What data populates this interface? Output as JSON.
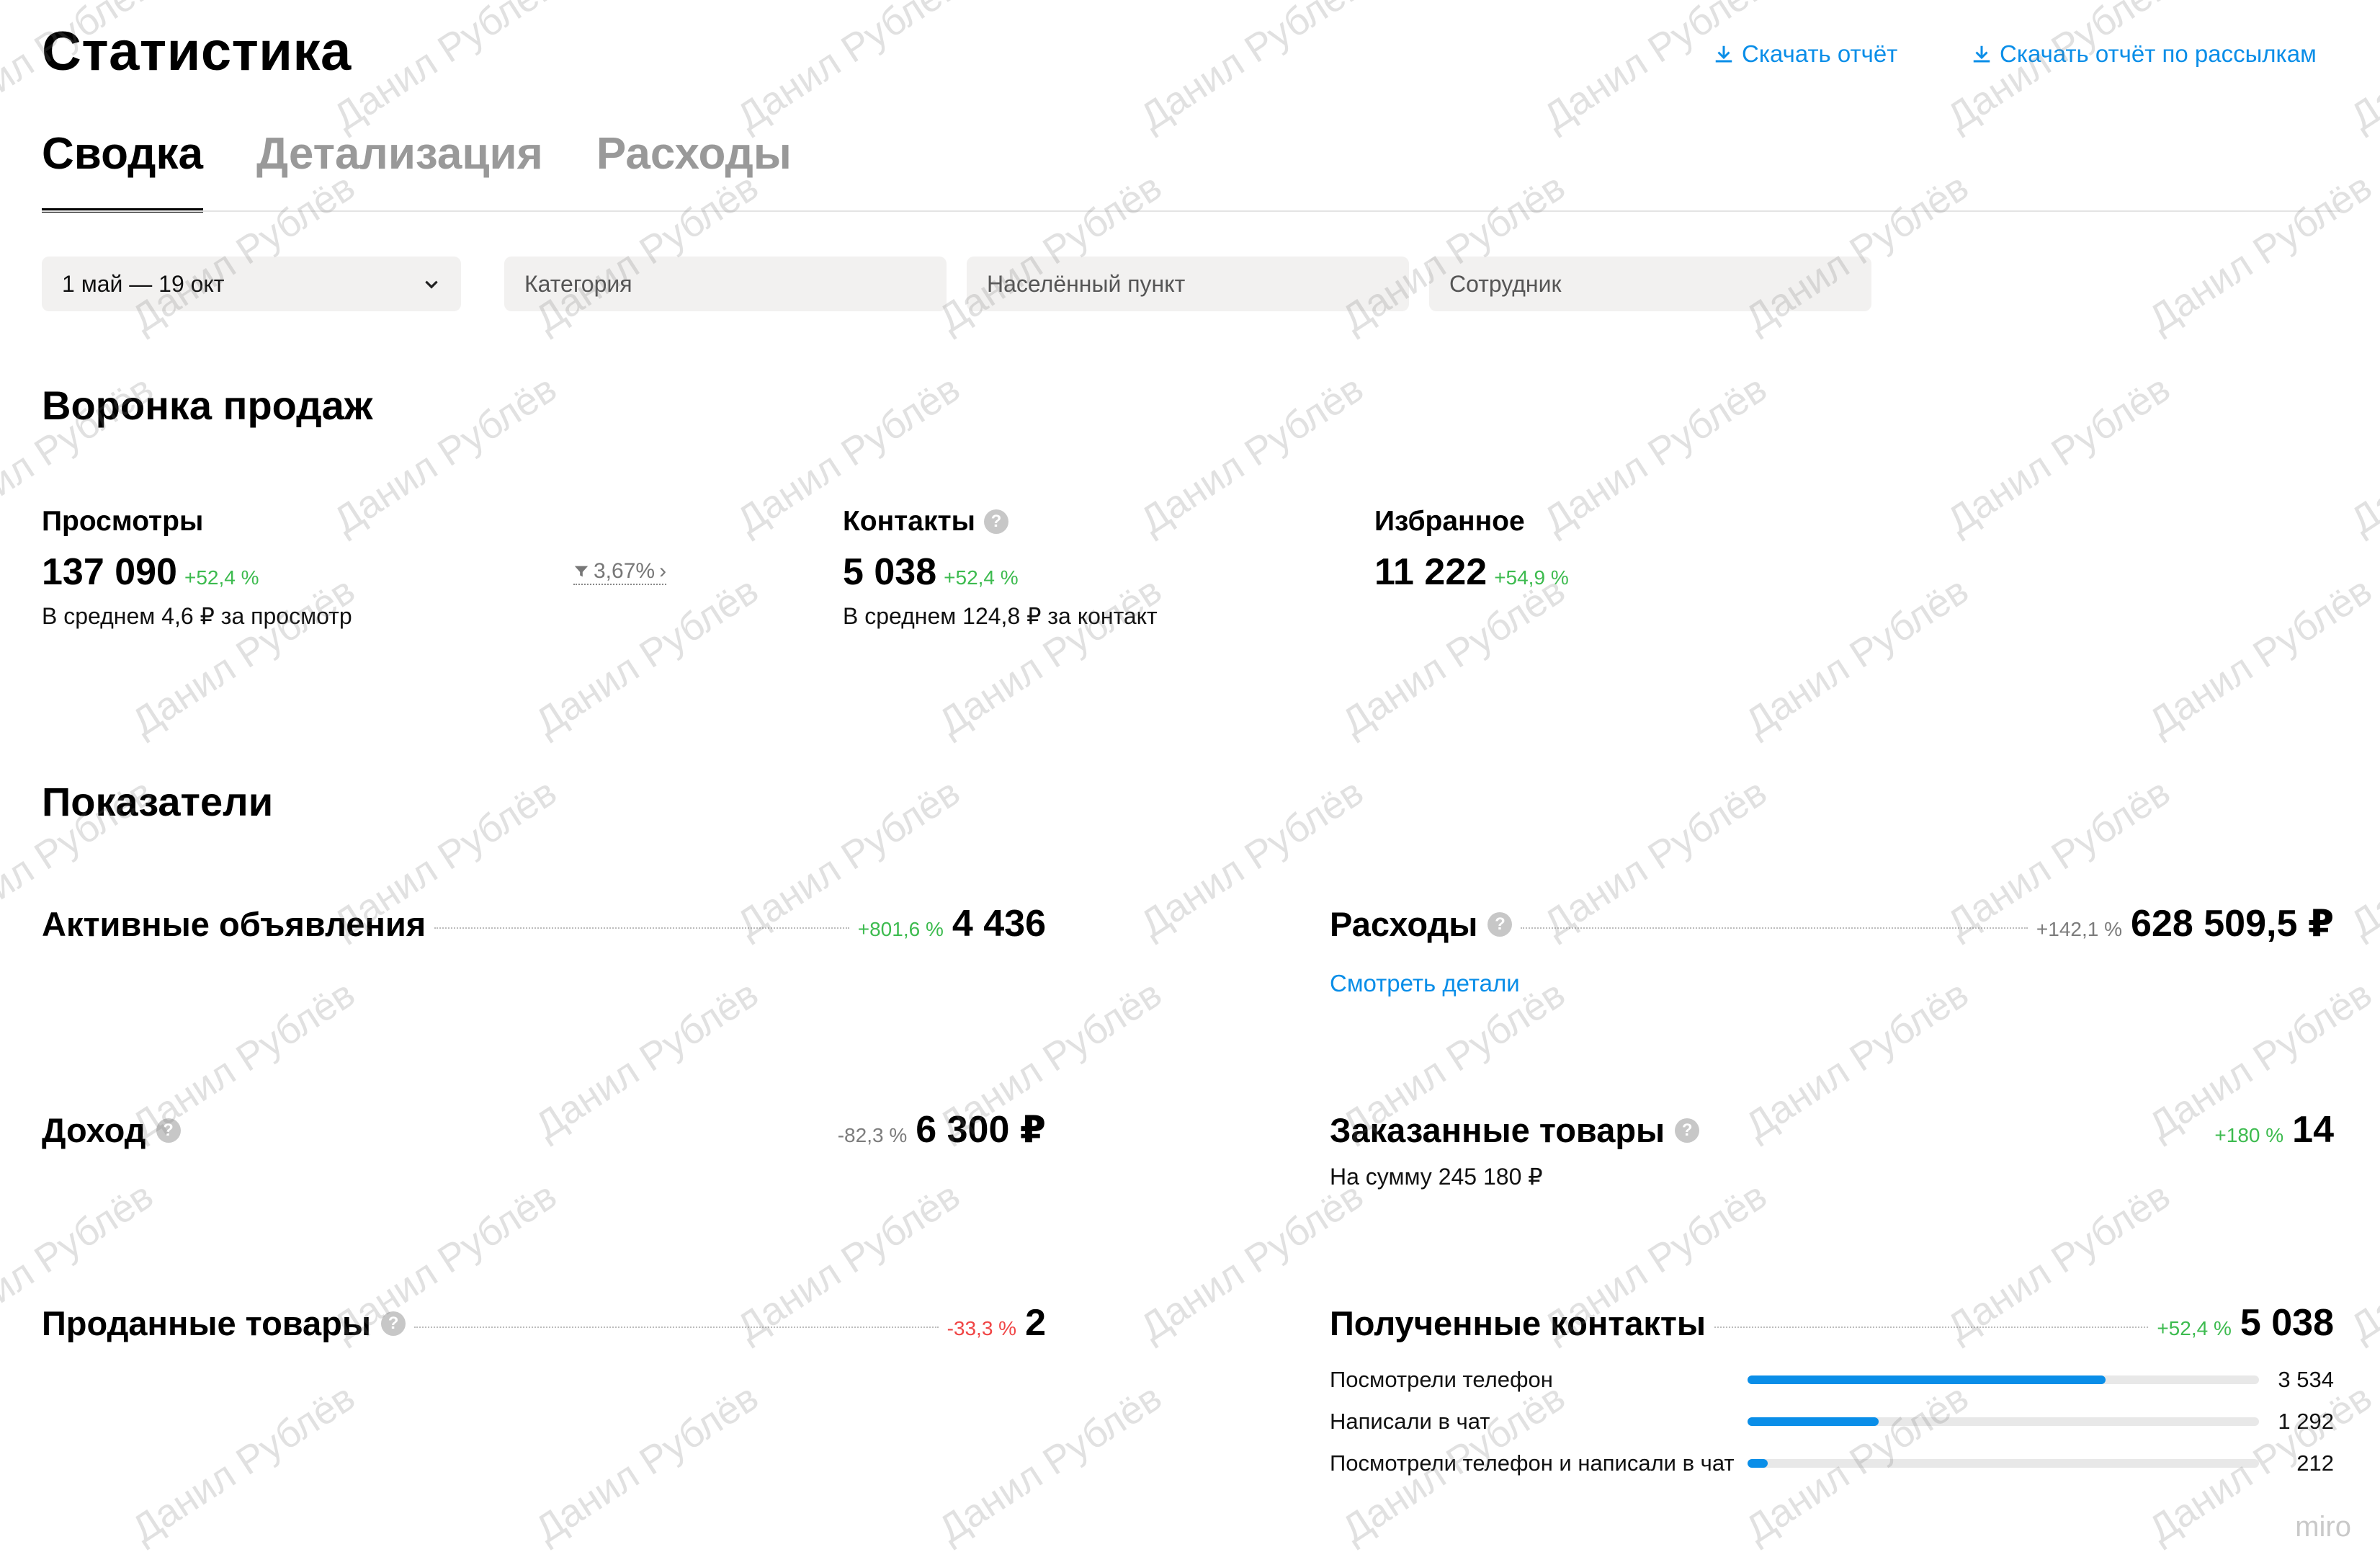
{
  "header": {
    "title": "Статистика",
    "download_report": "Скачать отчёт",
    "download_mailing_report": "Скачать отчёт по рассылкам"
  },
  "tabs": [
    {
      "label": "Сводка",
      "active": true
    },
    {
      "label": "Детализация",
      "active": false
    },
    {
      "label": "Расходы",
      "active": false
    }
  ],
  "filters": {
    "date": "1 май — 19 окт",
    "category_placeholder": "Категория",
    "city_placeholder": "Населённый пункт",
    "employee_placeholder": "Сотрудник"
  },
  "funnel": {
    "title": "Воронка продаж",
    "views": {
      "label": "Просмотры",
      "value": "137 090",
      "change": "+52,4 %",
      "sub": "В среднем 4,6 ₽ за просмотр"
    },
    "conversion": "3,67%",
    "contacts": {
      "label": "Контакты",
      "value": "5 038",
      "change": "+52,4 %",
      "sub": "В среднем 124,8 ₽ за контакт"
    },
    "favorites": {
      "label": "Избранное",
      "value": "11 222",
      "change": "+54,9 %"
    }
  },
  "metrics": {
    "title": "Показатели",
    "active_ads": {
      "label": "Активные объявления",
      "change": "+801,6 %",
      "value": "4 436"
    },
    "expenses": {
      "label": "Расходы",
      "change": "+142,1 %",
      "value": "628 509,5 ₽",
      "link": "Смотреть детали"
    },
    "income": {
      "label": "Доход",
      "change": "-82,3 %",
      "value": "6 300 ₽"
    },
    "ordered_goods": {
      "label": "Заказанные товары",
      "change": "+180 %",
      "value": "14",
      "sub": "На сумму 245 180 ₽"
    },
    "sold_goods": {
      "label": "Проданные товары",
      "change": "-33,3 %",
      "value": "2"
    },
    "received_contacts": {
      "label": "Полученные контакты",
      "change": "+52,4 %",
      "value": "5 038",
      "breakdown": [
        {
          "label": "Посмотрели телефон",
          "value": "3 534",
          "fraction": 0.7
        },
        {
          "label": "Написали в чат",
          "value": "1 292",
          "fraction": 0.256
        },
        {
          "label": "Посмотрели телефон и написали в чат",
          "value": "212",
          "fraction": 0.04
        }
      ]
    }
  },
  "watermark": "Данил Рублёв",
  "corner_mark": "miro",
  "colors": {
    "accent": "#0a8ee8",
    "positive": "#3dbb4f",
    "negative": "#f04545"
  }
}
